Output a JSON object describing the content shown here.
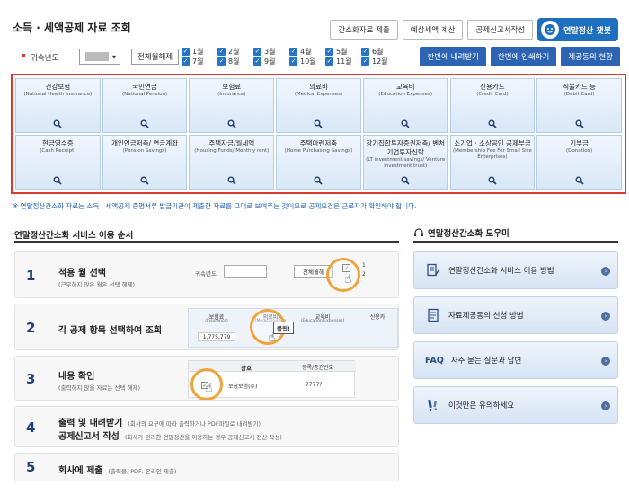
{
  "header": {
    "title": "소득 · 세액공제 자료 조회",
    "buttons": [
      "간소화자료 제출",
      "예상세액 계산",
      "공제신고서작성"
    ],
    "chatbot_label": "연말정산 챗봇"
  },
  "filter": {
    "year_label": "귀속년도",
    "deselect_label": "전체월해제",
    "months": [
      "1월",
      "2월",
      "3월",
      "4월",
      "5월",
      "6월",
      "7월",
      "8월",
      "9월",
      "10월",
      "11월",
      "12월"
    ],
    "actions": [
      "한번에 내려받기",
      "한번에 인쇄하기",
      "제공동의 현황"
    ]
  },
  "categories": [
    {
      "ko": "건강보험",
      "en": "(National Health Insurance)"
    },
    {
      "ko": "국민연금",
      "en": "(National Pension)"
    },
    {
      "ko": "보험료",
      "en": "(Insurance)"
    },
    {
      "ko": "의료비",
      "en": "(Medical Expenses)"
    },
    {
      "ko": "교육비",
      "en": "(Education Expenses)"
    },
    {
      "ko": "신용카드",
      "en": "(Credit Card)"
    },
    {
      "ko": "직불카드 등",
      "en": "(Debit Card)"
    },
    {
      "ko": "현금영수증",
      "en": "(Cash Receipt)"
    },
    {
      "ko": "개인연금저축/ 연금계좌",
      "en": "(Pension Savings)"
    },
    {
      "ko": "주택자금/월세액",
      "en": "(Housing Funds/ Monthly rent)"
    },
    {
      "ko": "주택마련저축",
      "en": "(Home Purchasing Savings)"
    },
    {
      "ko": "장기집합투자증권저축/ 벤처기업투자신탁",
      "en": "(LT investment savings/ Venture investment trust)"
    },
    {
      "ko": "소기업 · 소상공인 공제부금",
      "en": "(Membership Fee For Small Size Enterprises)"
    },
    {
      "ko": "기부금",
      "en": "(Donation)"
    }
  ],
  "notice": "※ 연말정산간소화 자료는 소득 · 세액공제 증명서류 발급기관이 제출한 자료를 그대로 보여주는 것이므로 공제요건은 근로자가 확인해야 합니다.",
  "order": {
    "title": "연말정산간소화 서비스 이용 순서",
    "steps": [
      {
        "num": "1",
        "title": "적용 월 선택",
        "sub": "(근무하지 않은 월은 선택 해제)"
      },
      {
        "num": "2",
        "title": "각 공제 항목 선택하여 조회",
        "sub": ""
      },
      {
        "num": "3",
        "title": "내용 확인",
        "sub": "(출력하지 않을 자료는 선택 해제)"
      },
      {
        "num": "4",
        "title": "출력 및 내려받기",
        "title2": "공제신고서 작성",
        "sub": "(회사의 요구에 따라 출력하거나 PDF파일로 내려받기)",
        "sub2": "(회사가 편리한 연말정산을 이용하는 경우 공제신고서 전산 작성)"
      },
      {
        "num": "5",
        "title": "회사에 제출",
        "sub": "(출력물, PDF, 온라인 제출)"
      }
    ],
    "mock1": {
      "year_label": "귀속년도",
      "btn": "전체월해",
      "m1": "1",
      "m2": "2"
    },
    "mock2": {
      "c1": "보험료",
      "c1en": "(Insurance)",
      "c2": "의료비",
      "c2en": "(Medical Expen",
      "c3": "교육비",
      "c3en": "(Education Expenses)",
      "c4": "신용카",
      "value": "1,775,779",
      "click": "클릭!"
    },
    "mock3": {
      "h1": "상호",
      "h2": "등록/증권번호",
      "row": "보장보험(주)",
      "num": "7777?"
    }
  },
  "helper": {
    "title": "연말정산간소화 도우미",
    "items": [
      {
        "icon": "document-pen-icon",
        "label": "연말정산간소화 서비스 이용 방법"
      },
      {
        "icon": "document-icon",
        "label": "자료제공동의 신청 방법"
      },
      {
        "icon": "faq-icon",
        "label": "자주 묻는 질문과 답변",
        "badge": "FAQ"
      },
      {
        "icon": "exclamation-icon",
        "label": "이것만은 유의하세요"
      }
    ]
  }
}
